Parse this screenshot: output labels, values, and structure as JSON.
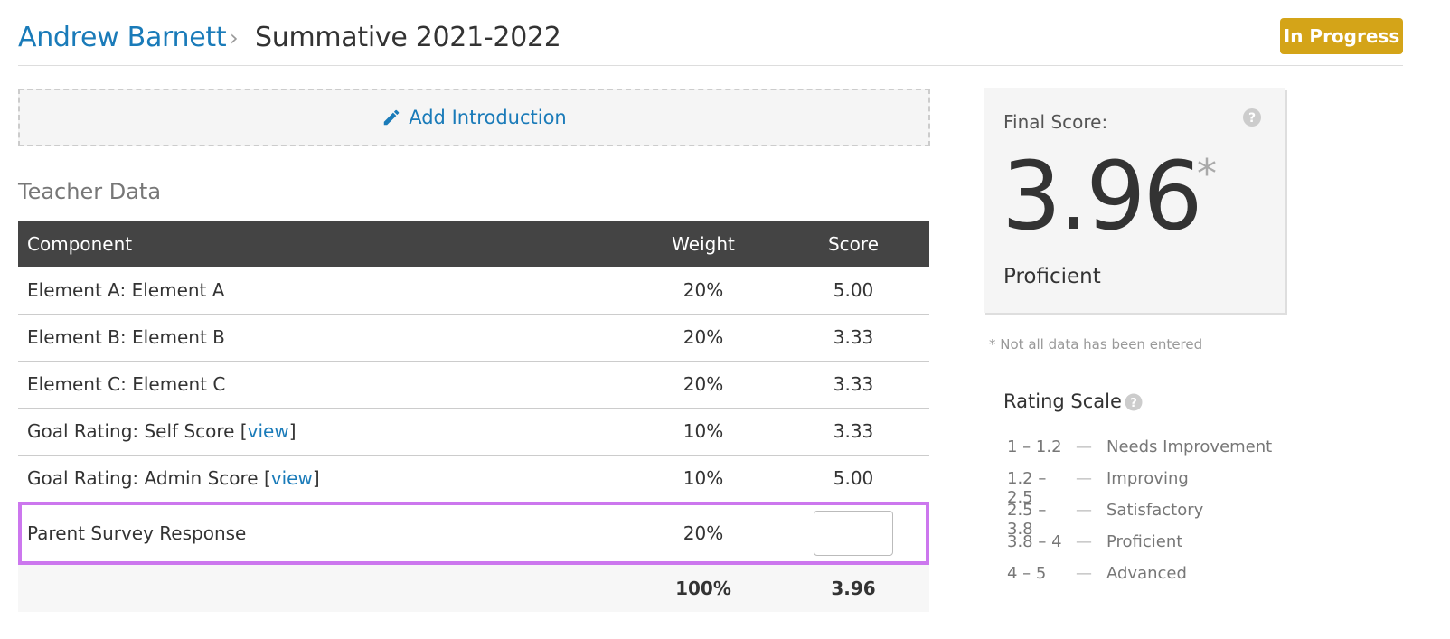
{
  "breadcrumb": {
    "teacher": "Andrew Barnett",
    "separator": "›",
    "evaluation": "Summative 2021-2022"
  },
  "status": {
    "label": "In Progress",
    "color": "#d4a418"
  },
  "intro": {
    "label": "Add Introduction",
    "icon": "pencil-icon"
  },
  "section": {
    "title": "Teacher Data"
  },
  "table": {
    "headers": {
      "component": "Component",
      "weight": "Weight",
      "score": "Score"
    },
    "rows": [
      {
        "component": "Element A: Element A",
        "weight": "20%",
        "score": "5.00"
      },
      {
        "component": "Element B: Element B",
        "weight": "20%",
        "score": "3.33"
      },
      {
        "component": "Element C: Element C",
        "weight": "20%",
        "score": "3.33"
      },
      {
        "component": "Goal Rating: Self Score [",
        "link": "view",
        "suffix": "]",
        "weight": "10%",
        "score": "3.33"
      },
      {
        "component": "Goal Rating: Admin Score [",
        "link": "view",
        "suffix": "]",
        "weight": "10%",
        "score": "5.00"
      },
      {
        "component": "Parent Survey Response",
        "weight": "20%",
        "score": ""
      }
    ],
    "totals": {
      "weight": "100%",
      "score": "3.96"
    }
  },
  "final": {
    "label": "Final Score:",
    "score": "3.96",
    "asterisk": "*",
    "level": "Proficient"
  },
  "note": "* Not all data has been entered",
  "rating_scale": {
    "title": "Rating Scale",
    "dash": "—",
    "items": [
      {
        "range": "1 – 1.2",
        "label": "Needs Improvement"
      },
      {
        "range": "1.2 – 2.5",
        "label": "Improving"
      },
      {
        "range": "2.5 – 3.8",
        "label": "Satisfactory"
      },
      {
        "range": "3.8 – 4",
        "label": "Proficient"
      },
      {
        "range": "4 – 5",
        "label": "Advanced"
      }
    ]
  }
}
